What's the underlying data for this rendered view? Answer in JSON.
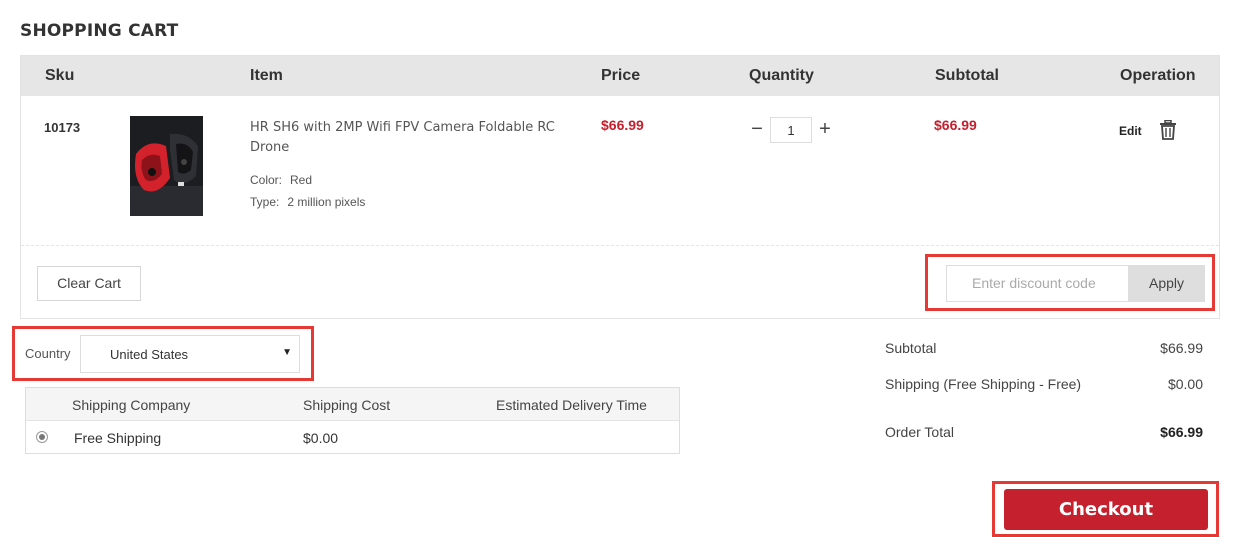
{
  "page": {
    "title": "SHOPPING CART"
  },
  "cart": {
    "columns": [
      "Sku",
      "Item",
      "Price",
      "Quantity",
      "Subtotal",
      "Operation"
    ],
    "items": [
      {
        "sku": "10173",
        "name": "HR SH6 with 2MP Wifi FPV Camera Foldable RC Drone",
        "attributes": [
          {
            "key": "Color:",
            "value": "Red"
          },
          {
            "key": "Type:",
            "value": "2 million pixels"
          }
        ],
        "price": "$66.99",
        "quantity": "1",
        "subtotal": "$66.99",
        "edit_label": "Edit"
      }
    ],
    "clear_label": "Clear Cart",
    "discount": {
      "placeholder": "Enter discount code",
      "apply_label": "Apply"
    }
  },
  "shipping": {
    "country_label": "Country",
    "country_value": "United States",
    "columns": [
      "Shipping Company",
      "Shipping Cost",
      "Estimated Delivery Time"
    ],
    "options": [
      {
        "company": "Free Shipping",
        "cost": "$0.00",
        "delivery": ""
      }
    ]
  },
  "summary": {
    "subtotal_label": "Subtotal",
    "subtotal_value": "$66.99",
    "shipping_label": "Shipping (Free Shipping - Free)",
    "shipping_value": "$0.00",
    "total_label": "Order Total",
    "total_value": "$66.99"
  },
  "checkout_label": "Checkout",
  "colors": {
    "accent": "#c4202e",
    "highlight": "#e53935"
  }
}
